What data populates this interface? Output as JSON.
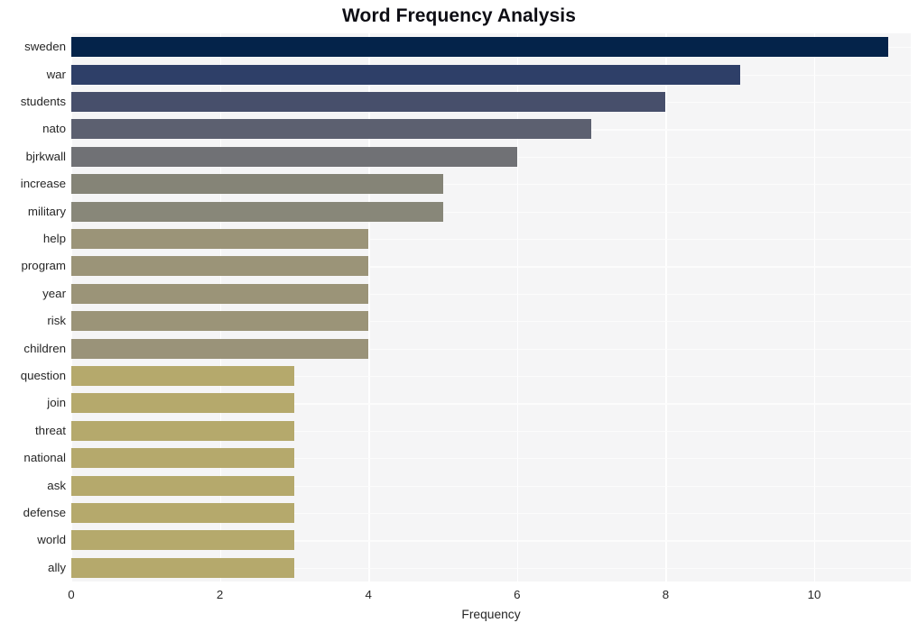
{
  "chart_data": {
    "type": "bar",
    "orientation": "horizontal",
    "title": "Word Frequency Analysis",
    "xlabel": "Frequency",
    "ylabel": "",
    "xlim": [
      0,
      11.3
    ],
    "xticks": [
      0,
      2,
      4,
      6,
      8,
      10
    ],
    "xticklabels": [
      "0",
      "2",
      "4",
      "6",
      "8",
      "10"
    ],
    "grid": true,
    "grid_color": "#ffffff",
    "plot_background": "#f5f5f6",
    "legend": null,
    "categories": [
      "sweden",
      "war",
      "students",
      "nato",
      "bjrkwall",
      "increase",
      "military",
      "help",
      "program",
      "year",
      "risk",
      "children",
      "question",
      "join",
      "threat",
      "national",
      "ask",
      "defense",
      "world",
      "ally"
    ],
    "values": [
      11,
      9,
      8,
      7,
      6,
      5,
      5,
      4,
      4,
      4,
      4,
      4,
      3,
      3,
      3,
      3,
      3,
      3,
      3,
      3
    ],
    "bar_colors": [
      "#04234a",
      "#2e3f६8",
      "#2e3f68",
      "#474f6b",
      "#5c6070",
      "#707175",
      "#858477",
      "#88877a",
      "#9b9478",
      "#9b9478",
      "#9b9478",
      "#9b9478",
      "#9a9379",
      "#b5a96c",
      "#b5a96c",
      "#b5a96c",
      "#b5a96c",
      "#b5a96c",
      "#b5a96c",
      "#b5a96c",
      "#b5a96c"
    ]
  },
  "palette": {
    "sweden": "#04234a",
    "war": "#2e3f68",
    "students": "#474f6b",
    "nato": "#5c6070",
    "bjrkwall": "#707175",
    "increase": "#858477",
    "military": "#888779",
    "help": "#9b9478",
    "program": "#9b9478",
    "year": "#9b9478",
    "risk": "#9b9478",
    "children": "#9a9379",
    "question": "#b5a96c",
    "join": "#b5a96c",
    "threat": "#b5a96c",
    "national": "#b5a96c",
    "ask": "#b5a96c",
    "defense": "#b5a96c",
    "world": "#b5a96c",
    "ally": "#b5a96c"
  }
}
